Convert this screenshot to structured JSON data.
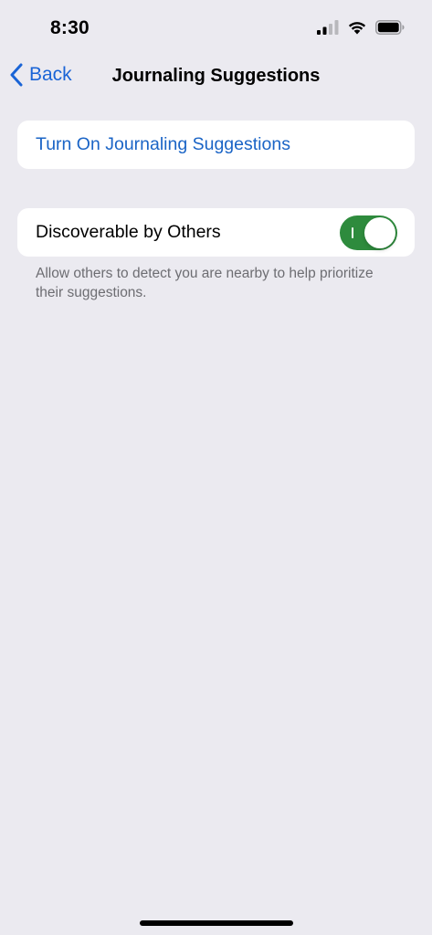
{
  "status_bar": {
    "time": "8:30",
    "icons": [
      "cellular-signal-icon",
      "wifi-icon",
      "battery-icon"
    ]
  },
  "nav": {
    "back_label": "Back",
    "back_icon": "chevron-left-icon",
    "title": "Journaling Suggestions"
  },
  "actions": {
    "turn_on_label": "Turn On Journaling Suggestions"
  },
  "discoverable": {
    "label": "Discoverable by Others",
    "enabled": true,
    "footer": "Allow others to detect you are nearby to help prioritize their suggestions."
  },
  "colors": {
    "accent": "#1a64d6",
    "toggle_on": "#2e8b3d",
    "background": "#ebeaf0",
    "card": "#ffffff",
    "footer_text": "#6d6d72"
  }
}
